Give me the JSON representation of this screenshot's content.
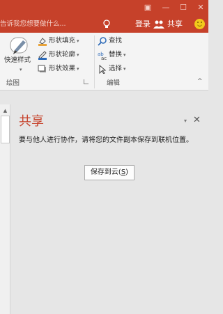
{
  "colors": {
    "accent": "#c6412a",
    "ribbon_bg": "#f4f4f4",
    "pane_bg": "#e6e6e6",
    "smiley": "#f2c91b"
  },
  "window": {
    "restore_glyph": "▣",
    "minimize_glyph": "—",
    "maximize_glyph": "☐",
    "close_glyph": "✕"
  },
  "command_bar": {
    "tell_me_placeholder": "告诉我您想要做什么...",
    "login_label": "登录",
    "share_label": "共享",
    "icons": [
      "lightbulb-icon",
      "people-icon",
      "smiley-icon"
    ]
  },
  "ribbon": {
    "quick_styles_label": "快速样式",
    "shape_fill_label": "形状填充",
    "shape_outline_label": "形状轮廓",
    "shape_effects_label": "形状效果",
    "find_label": "查找",
    "replace_label": "替换",
    "select_label": "选择",
    "group_drawing": "绘图",
    "group_editing": "编辑",
    "dropdown_glyph": "▾",
    "collapse_glyph": "^"
  },
  "share_pane": {
    "title": "共享",
    "options_glyph": "▾",
    "close_glyph": "✕",
    "description": "要与他人进行协作，请将您的文件副本保存到联机位置。",
    "save_button_text": "保存到云(",
    "save_button_key": "S",
    "save_button_close": ")"
  },
  "scrollbar": {
    "up_glyph": "▲"
  }
}
